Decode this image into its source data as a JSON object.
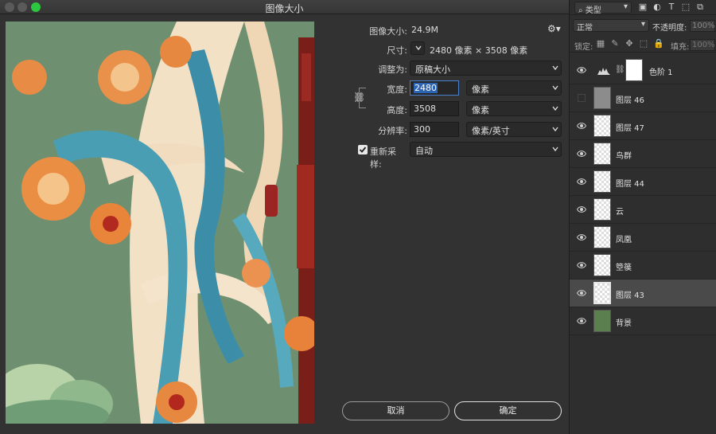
{
  "window": {
    "title": "图像大小"
  },
  "info": {
    "size_label": "图像大小:",
    "size_value": "24.9M",
    "dims_label": "尺寸:",
    "dims_value": "2480 像素 × 3508 像素"
  },
  "fit": {
    "label": "调整为:",
    "value": "原稿大小"
  },
  "width": {
    "label": "宽度:",
    "value": "2480",
    "unit": "像素"
  },
  "height": {
    "label": "高度:",
    "value": "3508",
    "unit": "像素"
  },
  "resolution": {
    "label": "分辨率:",
    "value": "300",
    "unit": "像素/英寸"
  },
  "resample": {
    "label": "重新采样:",
    "value": "自动",
    "checked": true
  },
  "buttons": {
    "cancel": "取消",
    "ok": "确定"
  },
  "layers_panel": {
    "filter_label": "类型",
    "blend_mode": "正常",
    "opacity_label": "不透明度:",
    "opacity_value": "100%",
    "lock_label": "锁定:",
    "fill_label": "填充:",
    "fill_value": "100%",
    "layers": [
      {
        "name": "色阶 1",
        "visible": true,
        "type": "adjustment"
      },
      {
        "name": "图层 46",
        "visible": false,
        "type": "gray"
      },
      {
        "name": "图层 47",
        "visible": true,
        "type": "checker"
      },
      {
        "name": "鸟群",
        "visible": true,
        "type": "checker"
      },
      {
        "name": "图层 44",
        "visible": true,
        "type": "checker"
      },
      {
        "name": "云",
        "visible": true,
        "type": "checker"
      },
      {
        "name": "凤凰",
        "visible": true,
        "type": "checker"
      },
      {
        "name": "箜篌",
        "visible": true,
        "type": "checker"
      },
      {
        "name": "图层 43",
        "visible": true,
        "type": "checker",
        "active": true
      },
      {
        "name": "背景",
        "visible": true,
        "type": "green"
      }
    ]
  },
  "colors": {
    "accent": "#2c64b4",
    "traffic_green": "#2bc840",
    "preview_bg": "#6f9070"
  }
}
